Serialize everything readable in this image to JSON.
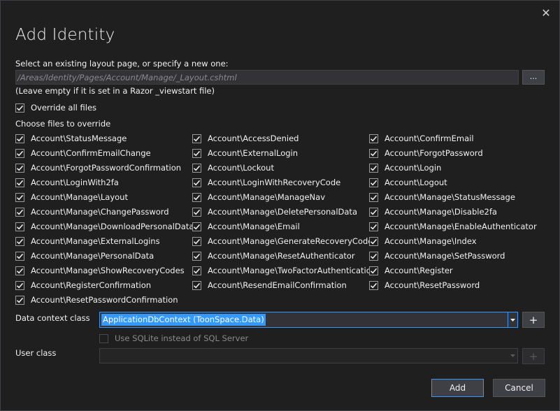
{
  "dialog": {
    "title": "Add Identity",
    "close_glyph": "✕"
  },
  "layout": {
    "label": "Select an existing layout page, or specify a new one:",
    "value": "/Areas/Identity/Pages/Account/Manage/_Layout.cshtml",
    "browse_label": "...",
    "hint": "(Leave empty if it is set in a Razor _viewstart file)"
  },
  "override_all": {
    "label": "Override all files",
    "checked": true
  },
  "files_header": "Choose files to override",
  "files": [
    "Account\\StatusMessage",
    "Account\\AccessDenied",
    "Account\\ConfirmEmail",
    "Account\\ConfirmEmailChange",
    "Account\\ExternalLogin",
    "Account\\ForgotPassword",
    "Account\\ForgotPasswordConfirmation",
    "Account\\Lockout",
    "Account\\Login",
    "Account\\LoginWith2fa",
    "Account\\LoginWithRecoveryCode",
    "Account\\Logout",
    "Account\\Manage\\Layout",
    "Account\\Manage\\ManageNav",
    "Account\\Manage\\StatusMessage",
    "Account\\Manage\\ChangePassword",
    "Account\\Manage\\DeletePersonalData",
    "Account\\Manage\\Disable2fa",
    "Account\\Manage\\DownloadPersonalData",
    "Account\\Manage\\Email",
    "Account\\Manage\\EnableAuthenticator",
    "Account\\Manage\\ExternalLogins",
    "Account\\Manage\\GenerateRecoveryCodes",
    "Account\\Manage\\Index",
    "Account\\Manage\\PersonalData",
    "Account\\Manage\\ResetAuthenticator",
    "Account\\Manage\\SetPassword",
    "Account\\Manage\\ShowRecoveryCodes",
    "Account\\Manage\\TwoFactorAuthentication",
    "Account\\Register",
    "Account\\RegisterConfirmation",
    "Account\\ResendEmailConfirmation",
    "Account\\ResetPassword",
    "Account\\ResetPasswordConfirmation"
  ],
  "data_context": {
    "label": "Data context class",
    "value": "ApplicationDbContext (ToonSpace.Data)",
    "add_glyph": "+"
  },
  "sqlite": {
    "label": "Use SQLite instead of SQL Server",
    "checked": false
  },
  "user_class": {
    "label": "User class",
    "value": "",
    "add_glyph": "+"
  },
  "buttons": {
    "add": "Add",
    "cancel": "Cancel"
  },
  "colors": {
    "background": "#1f1f1f",
    "accent": "#3399ff",
    "text": "#f1f1f1",
    "muted": "#8a8a8a"
  },
  "icons": {
    "close": "close-icon",
    "checkmark": "checkmark-icon",
    "dropdown": "chevron-down-icon",
    "add": "plus-icon"
  }
}
